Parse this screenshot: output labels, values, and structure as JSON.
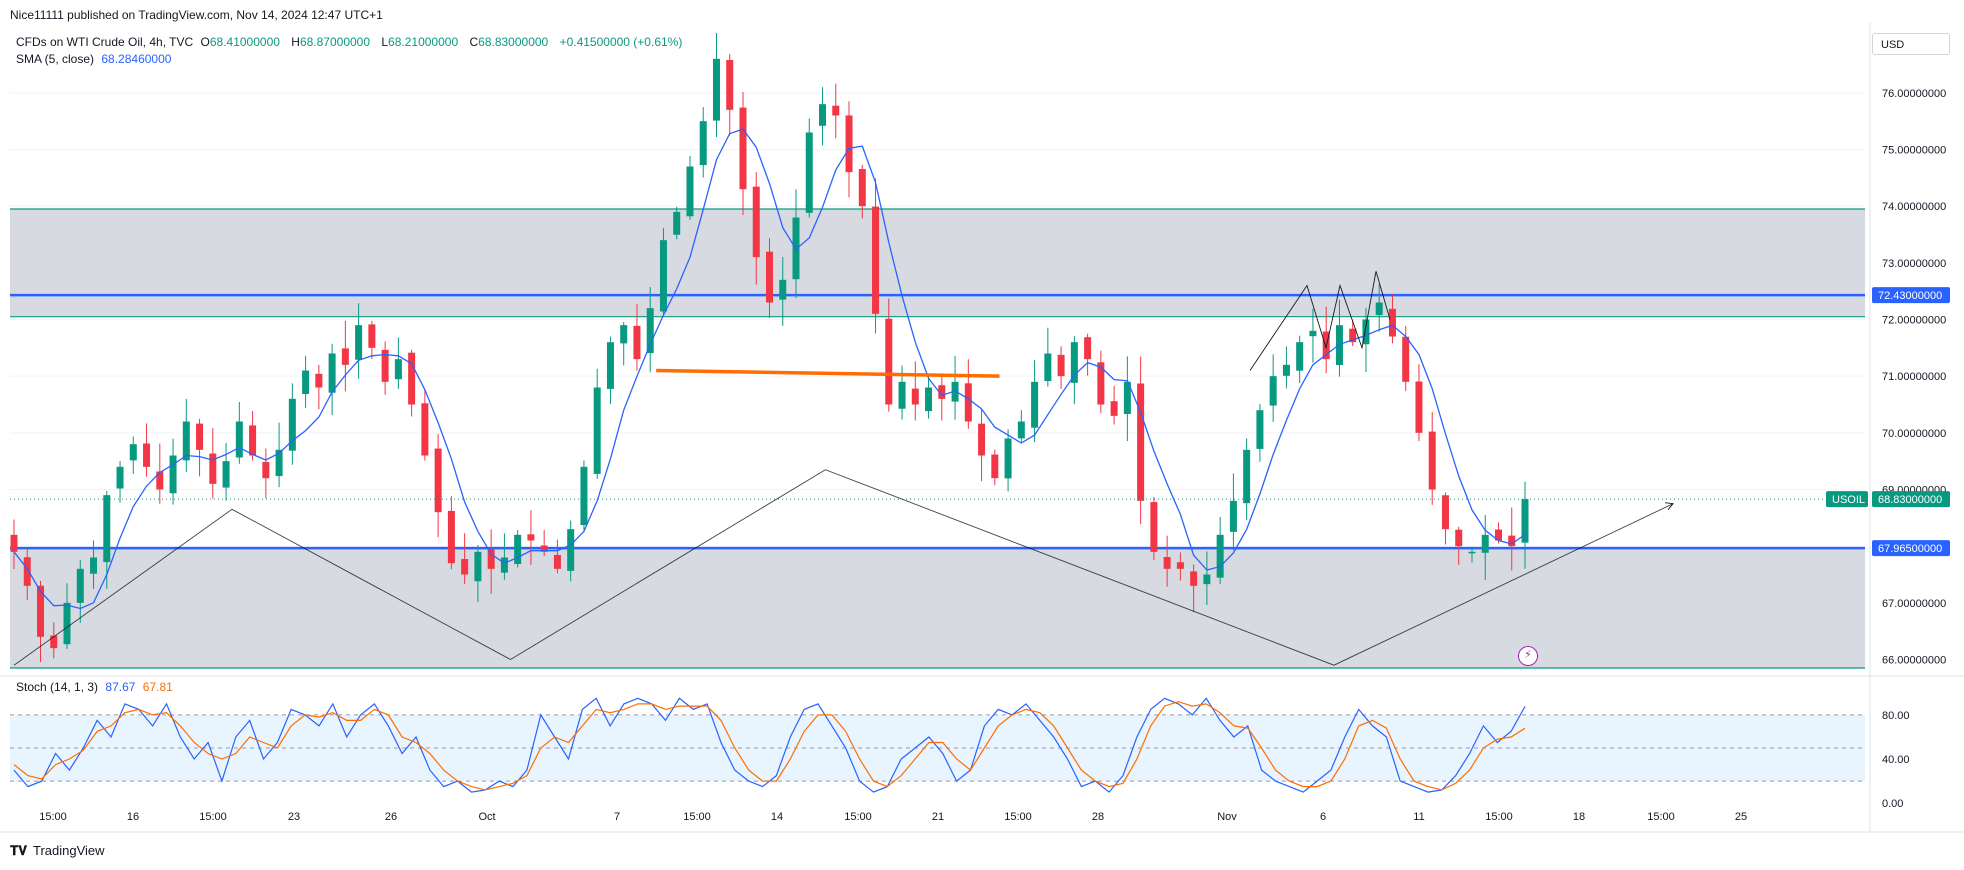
{
  "publisher": "Nice11111 published on TradingView.com, Nov 14, 2024 12:47 UTC+1",
  "instrument": {
    "title": "CFDs on WTI Crude Oil, 4h, TVC",
    "open_label": "O",
    "open": "68.41000000",
    "high_label": "H",
    "high": "68.87000000",
    "low_label": "L",
    "low": "68.21000000",
    "close_label": "C",
    "close": "68.83000000",
    "change": "+0.41500000 (+0.61%)"
  },
  "sma": {
    "label": "SMA (5, close)",
    "value": "68.28460000"
  },
  "stoch": {
    "label": "Stoch (14, 1, 3)",
    "k": "87.67",
    "d": "67.81"
  },
  "currency": "USD",
  "brand": "TradingView",
  "colors": {
    "up": "#089981",
    "down": "#f23645",
    "sma": "#2962ff",
    "stoch_k": "#2962ff",
    "stoch_d": "#ff6d00",
    "zone": "#d1d4dc",
    "level": "#2962ff",
    "zone_edge": "#089981",
    "trendline": "#ff6d00",
    "pattern": "#131722"
  },
  "chart_data": [
    {
      "type": "candlestick",
      "timeframe": "4h",
      "x_tick_labels": [
        "15:00",
        "16",
        "15:00",
        "23",
        "26",
        "Oct",
        "7",
        "15:00",
        "14",
        "15:00",
        "21",
        "15:00",
        "28",
        "Nov",
        "6",
        "11",
        "15:00",
        "18",
        "15:00",
        "25"
      ],
      "ylim": [
        65.85,
        77.25
      ],
      "y_tick_labels": [
        "66.00000000",
        "67.00000000",
        "68.00000000",
        "69.00000000",
        "70.00000000",
        "71.00000000",
        "72.00000000",
        "73.00000000",
        "74.00000000",
        "75.00000000",
        "76.00000000"
      ],
      "y_ticks": [
        66,
        67,
        68,
        69,
        70,
        71,
        72,
        73,
        74,
        75,
        76
      ],
      "close_path": [
        67.9,
        67.3,
        66.4,
        66.2,
        67.0,
        67.6,
        67.8,
        68.9,
        69.4,
        69.8,
        69.4,
        69.0,
        69.6,
        70.2,
        69.7,
        69.1,
        69.5,
        70.2,
        69.6,
        69.2,
        69.7,
        70.6,
        71.1,
        70.8,
        71.4,
        71.2,
        71.9,
        71.5,
        70.9,
        71.3,
        70.5,
        69.6,
        68.6,
        67.7,
        67.5,
        67.9,
        67.6,
        67.8,
        68.2,
        68.1,
        67.9,
        67.6,
        68.3,
        69.4,
        70.8,
        71.6,
        71.9,
        71.3,
        72.2,
        73.4,
        73.9,
        74.7,
        75.5,
        76.6,
        75.7,
        74.3,
        73.1,
        72.3,
        72.7,
        73.8,
        75.3,
        75.8,
        75.6,
        74.6,
        74.0,
        72.1,
        70.5,
        70.9,
        70.5,
        70.8,
        70.6,
        70.9,
        70.2,
        69.6,
        69.2,
        69.9,
        70.2,
        70.9,
        71.4,
        71.0,
        71.6,
        71.3,
        70.5,
        70.3,
        70.9,
        68.8,
        67.9,
        67.6,
        67.6,
        67.3,
        67.5,
        68.2,
        68.8,
        69.7,
        70.4,
        71.0,
        71.2,
        71.6,
        71.8,
        71.3,
        71.9,
        71.6,
        72.0,
        72.3,
        71.7,
        70.9,
        70.0,
        69.0,
        68.3,
        68.0,
        67.9,
        68.2,
        68.1,
        68.0,
        68.83
      ],
      "zones": [
        {
          "name": "resistance-zone",
          "low": 72.05,
          "high": 73.95,
          "mid_level": 72.43
        },
        {
          "name": "support-zone",
          "low": 65.85,
          "high": 67.965,
          "mid_level": 67.965
        }
      ],
      "levels": [
        {
          "value": 72.43,
          "label": "72.43000000",
          "color": "#2962ff"
        },
        {
          "value": 67.965,
          "label": "67.96500000",
          "color": "#2962ff"
        }
      ],
      "last_price": {
        "symbol": "USOIL",
        "value": 68.83,
        "label": "68.83000000"
      },
      "trendline": {
        "from": [
          0.425,
          71.1
        ],
        "to": [
          0.5,
          71.0
        ],
        "color": "#ff6d00"
      }
    },
    {
      "type": "line",
      "name": "Stoch (14, 1, 3)",
      "ylim": [
        -8,
        108
      ],
      "y_tick_labels": [
        "0.00",
        "40.00",
        "80.00"
      ],
      "y_ticks": [
        0,
        40,
        80
      ],
      "band": [
        20,
        80
      ],
      "series": [
        {
          "name": "%K",
          "color": "#2962ff",
          "values": [
            30,
            15,
            20,
            45,
            30,
            50,
            75,
            60,
            90,
            85,
            70,
            90,
            60,
            40,
            55,
            20,
            60,
            75,
            40,
            55,
            85,
            80,
            70,
            90,
            60,
            80,
            90,
            70,
            45,
            60,
            30,
            15,
            20,
            10,
            12,
            20,
            15,
            30,
            80,
            60,
            40,
            85,
            95,
            70,
            90,
            95,
            90,
            75,
            95,
            85,
            90,
            55,
            30,
            20,
            15,
            25,
            60,
            85,
            90,
            70,
            50,
            20,
            10,
            15,
            40,
            50,
            60,
            45,
            20,
            30,
            70,
            85,
            80,
            90,
            75,
            60,
            40,
            15,
            20,
            10,
            25,
            60,
            85,
            95,
            90,
            80,
            95,
            75,
            60,
            70,
            30,
            20,
            15,
            10,
            20,
            30,
            60,
            85,
            70,
            60,
            20,
            15,
            10,
            12,
            25,
            45,
            70,
            55,
            65,
            87.67
          ]
        },
        {
          "name": "%D",
          "color": "#ff6d00",
          "values": [
            35,
            25,
            22,
            35,
            40,
            48,
            65,
            70,
            82,
            85,
            80,
            82,
            70,
            55,
            45,
            40,
            45,
            60,
            55,
            50,
            70,
            80,
            78,
            82,
            75,
            75,
            85,
            80,
            60,
            55,
            45,
            30,
            20,
            15,
            12,
            15,
            18,
            25,
            50,
            60,
            55,
            70,
            85,
            82,
            85,
            90,
            90,
            85,
            88,
            88,
            88,
            75,
            50,
            30,
            20,
            20,
            40,
            65,
            80,
            80,
            65,
            40,
            20,
            15,
            25,
            40,
            55,
            55,
            40,
            30,
            50,
            70,
            80,
            85,
            82,
            70,
            50,
            30,
            20,
            15,
            18,
            40,
            70,
            88,
            92,
            88,
            90,
            82,
            70,
            68,
            50,
            30,
            20,
            15,
            15,
            20,
            40,
            70,
            75,
            68,
            40,
            20,
            15,
            12,
            18,
            30,
            50,
            58,
            60,
            67.81
          ]
        }
      ]
    }
  ]
}
